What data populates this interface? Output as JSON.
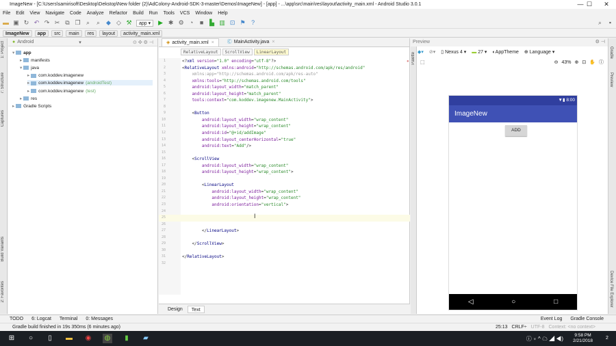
{
  "window": {
    "title": "ImageNew - [C:\\Users\\samirisoft\\Desktop\\Dekstop\\New folder (2)\\AdColony-Android-SDK-3-master\\Demos\\ImageNew] - [app] - ...\\app\\src\\main\\res\\layout\\activity_main.xml - Android Studio 3.0.1",
    "minimize": "—",
    "maximize": "☐",
    "close": "✕"
  },
  "menu": [
    "File",
    "Edit",
    "View",
    "Navigate",
    "Code",
    "Analyze",
    "Refactor",
    "Build",
    "Run",
    "Tools",
    "VCS",
    "Window",
    "Help"
  ],
  "toolbar": {
    "run_config": "app ▾",
    "help": "?"
  },
  "breadcrumbs": [
    "ImageNew",
    "app",
    "src",
    "main",
    "res",
    "layout",
    "activity_main.xml"
  ],
  "left_strip": [
    "1: Project",
    "7: Structure",
    "Captures",
    "Build Variants",
    "2: Favorites"
  ],
  "project": {
    "view": "Android",
    "tree": [
      {
        "label": "app",
        "level": 0,
        "bold": true
      },
      {
        "label": "manifests",
        "level": 1
      },
      {
        "label": "java",
        "level": 1
      },
      {
        "label": "com.koddev.imagenew",
        "level": 2
      },
      {
        "label": "com.koddev.imagenew",
        "suffix": "(androidTest)",
        "level": 2,
        "selected": true
      },
      {
        "label": "com.koddev.imagenew",
        "suffix": "(test)",
        "level": 2
      },
      {
        "label": "res",
        "level": 1
      },
      {
        "label": "Gradle Scripts",
        "level": 0
      }
    ]
  },
  "editor": {
    "tabs": [
      "activity_main.xml",
      "MainActivity.java"
    ],
    "xml_path": [
      "RelativeLayout",
      "ScrollView",
      "LinearLayout"
    ],
    "lines": [
      [
        [
          "pun",
          "<?"
        ],
        [
          "tag",
          "xml "
        ],
        [
          "attr",
          "version"
        ],
        [
          "pun",
          "="
        ],
        [
          "val",
          "\"1.0\""
        ],
        [
          "attr",
          " encoding"
        ],
        [
          "pun",
          "="
        ],
        [
          "val",
          "\"utf-8\""
        ],
        [
          "pun",
          "?>"
        ]
      ],
      [
        [
          "pun",
          "<"
        ],
        [
          "tag",
          "RelativeLayout "
        ],
        [
          "attr",
          "xmlns:android"
        ],
        [
          "pun",
          "="
        ],
        [
          "val",
          "\"http://schemas.android.com/apk/res/android\""
        ]
      ],
      [
        [
          "dim",
          "    xmlns:app=\"http://schemas.android.com/apk/res-auto\""
        ]
      ],
      [
        [
          "attr",
          "    xmlns:tools"
        ],
        [
          "pun",
          "="
        ],
        [
          "val",
          "\"http://schemas.android.com/tools\""
        ]
      ],
      [
        [
          "attr",
          "    android:layout_width"
        ],
        [
          "pun",
          "="
        ],
        [
          "val",
          "\"match_parent\""
        ]
      ],
      [
        [
          "attr",
          "    android:layout_height"
        ],
        [
          "pun",
          "="
        ],
        [
          "val",
          "\"match_parent\""
        ]
      ],
      [
        [
          "attr",
          "    tools:context"
        ],
        [
          "pun",
          "="
        ],
        [
          "val",
          "\"com.koddev.imagenew.MainActivity\""
        ],
        [
          "pun",
          ">"
        ]
      ],
      [],
      [
        [
          "pun",
          "    <"
        ],
        [
          "tag",
          "Button"
        ]
      ],
      [
        [
          "attr",
          "        android:layout_width"
        ],
        [
          "pun",
          "="
        ],
        [
          "val",
          "\"wrap_content\""
        ]
      ],
      [
        [
          "attr",
          "        android:layout_height"
        ],
        [
          "pun",
          "="
        ],
        [
          "val",
          "\"wrap_content\""
        ]
      ],
      [
        [
          "attr",
          "        android:id"
        ],
        [
          "pun",
          "="
        ],
        [
          "val",
          "\"@+id/addImage\""
        ]
      ],
      [
        [
          "attr",
          "        android:layout_centerHorizontal"
        ],
        [
          "pun",
          "="
        ],
        [
          "val",
          "\"true\""
        ]
      ],
      [
        [
          "attr",
          "        android:text"
        ],
        [
          "pun",
          "="
        ],
        [
          "val",
          "\"Add\""
        ],
        [
          "pun",
          "/>"
        ]
      ],
      [],
      [
        [
          "pun",
          "    <"
        ],
        [
          "tag",
          "ScrollView"
        ]
      ],
      [
        [
          "attr",
          "        android:layout_width"
        ],
        [
          "pun",
          "="
        ],
        [
          "val",
          "\"wrap_content\""
        ]
      ],
      [
        [
          "attr",
          "        android:layout_height"
        ],
        [
          "pun",
          "="
        ],
        [
          "val",
          "\"wrap_content\""
        ],
        [
          "pun",
          ">"
        ]
      ],
      [],
      [
        [
          "pun",
          "        <"
        ],
        [
          "tag",
          "LinearLayout"
        ]
      ],
      [
        [
          "attr",
          "            android:layout_width"
        ],
        [
          "pun",
          "="
        ],
        [
          "val",
          "\"wrap_content\""
        ]
      ],
      [
        [
          "attr",
          "            android:layout_height"
        ],
        [
          "pun",
          "="
        ],
        [
          "val",
          "\"wrap_content\""
        ]
      ],
      [
        [
          "attr",
          "            android:orientation"
        ],
        [
          "pun",
          "="
        ],
        [
          "val",
          "\"vertical\""
        ],
        [
          "pun",
          ">"
        ]
      ],
      [],
      [],
      [],
      [
        [
          "pun",
          "        </"
        ],
        [
          "tag",
          "LinearLayout"
        ],
        [
          "pun",
          ">"
        ]
      ],
      [],
      [
        [
          "pun",
          "    </"
        ],
        [
          "tag",
          "ScrollView"
        ],
        [
          "pun",
          ">"
        ]
      ],
      [],
      [
        [
          "pun",
          "</"
        ],
        [
          "tag",
          "RelativeLayout"
        ],
        [
          "pun",
          ">"
        ]
      ],
      []
    ],
    "bottom_tabs": [
      "Design",
      "Text"
    ]
  },
  "preview": {
    "title": "Preview",
    "device": "Nexus 4 ▾",
    "api": "27 ▾",
    "theme": "AppTheme",
    "language": "Language ▾",
    "zoom": "43%",
    "palette": "Palette",
    "phone": {
      "time": "8:00",
      "app_title": "ImageNew",
      "button": "ADD",
      "nav": [
        "◁",
        "○",
        "□"
      ]
    }
  },
  "right_strip": [
    "Gradle",
    "Preview",
    "Device File Explorer"
  ],
  "tool_windows": {
    "left": [
      "TODO",
      "6: Logcat",
      "Terminal",
      "0: Messages"
    ],
    "right": [
      "Event Log",
      "Gradle Console"
    ]
  },
  "status": {
    "message": "Gradle build finished in 19s 350ms (6 minutes ago)",
    "position": "25:13",
    "line_sep": "CRLF÷",
    "encoding": "UTF-8",
    "context": "Context: <no context>"
  },
  "taskbar": {
    "time": "9:58 PM",
    "date": "2/21/2018",
    "notifications": "2"
  }
}
